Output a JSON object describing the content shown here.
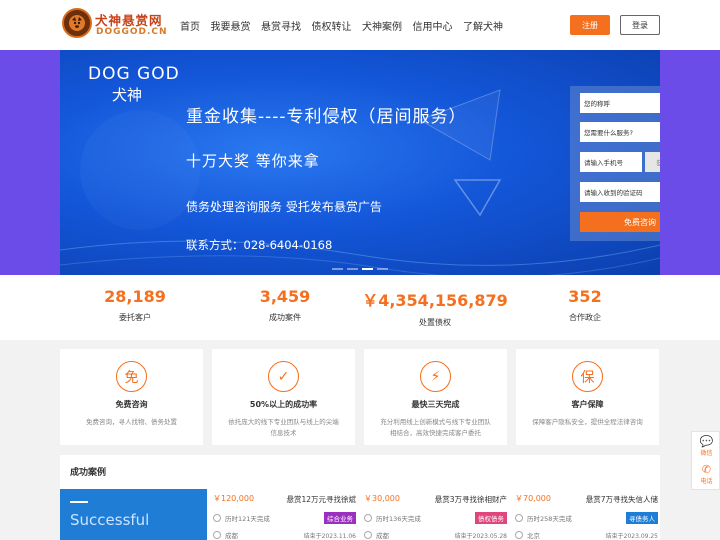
{
  "header": {
    "logo_title": "犬神悬赏网",
    "logo_sub": "DOGGOD.CN",
    "nav": [
      "首页",
      "我要悬赏",
      "悬赏寻找",
      "债权转让",
      "犬神案例",
      "信用中心",
      "了解犬神"
    ],
    "register": "注册",
    "login": "登录"
  },
  "banner": {
    "brand_en": "DOG GOD",
    "brand_cn": "犬神",
    "slogan1": "重金收集----专利侵权（居间服务）",
    "slogan2": "十万大奖    等你来拿",
    "slogan3": "债务处理咨询服务    受托发布悬赏广告",
    "slogan4": "联系方式：028-6404-0168",
    "slides": 4,
    "active_slide": 3
  },
  "form": {
    "name_placeholder": "您的称呼",
    "service_placeholder": "您需要什么服务?",
    "phone_placeholder": "请输入手机号",
    "get_code": "获取验证码",
    "code_placeholder": "请输入收到的验证码",
    "submit": "免费咨询"
  },
  "stats": [
    {
      "value": "28,189",
      "label": "委托客户"
    },
    {
      "value": "3,459",
      "label": "成功案件"
    },
    {
      "value": "￥4,354,156,879",
      "label": "处置债权"
    },
    {
      "value": "352",
      "label": "合作政企"
    }
  ],
  "features": [
    {
      "icon_text": "免",
      "title": "免费咨询",
      "desc": "免费咨询，寻人找物、债务处置"
    },
    {
      "icon_text": "✓",
      "title": "50%以上的成功率",
      "desc": "依托庞大的线下专业团队与线上的尖端信息技术"
    },
    {
      "icon_text": "⚡",
      "title": "最快三天完成",
      "desc": "充分利用线上创新模式与线下专业团队相结合，高效快捷完成客户委托"
    },
    {
      "icon_text": "保",
      "title": "客户保障",
      "desc": "保障客户隐私安全，提供全程法律咨询"
    }
  ],
  "cases": {
    "title": "成功案例",
    "promo_text": "Successful",
    "items": [
      {
        "price": "￥120,000",
        "name": "悬赏12万元寻找徐斌",
        "duration": "历时121天完成",
        "tag": "综合业务",
        "tag_color": "#9b2fbf",
        "location": "成都",
        "end": "结束于2023.11.06"
      },
      {
        "price": "￥30,000",
        "name": "悬赏3万寻找徐相财产",
        "duration": "历时136天完成",
        "tag": "债权债务",
        "tag_color": "#e0457b",
        "location": "成都",
        "end": "结束于2023.05.28"
      },
      {
        "price": "￥70,000",
        "name": "悬赏7万寻找失信人储",
        "duration": "历时258天完成",
        "tag": "寻债务人",
        "tag_color": "#1f7dd6",
        "location": "北京",
        "end": "结束于2023.09.25"
      }
    ]
  },
  "float": {
    "wechat": "微信",
    "phone": "电话"
  },
  "colors": {
    "accent": "#f4701f",
    "banner_bg": "#6c4ce8",
    "promo": "#1f7dd6"
  }
}
